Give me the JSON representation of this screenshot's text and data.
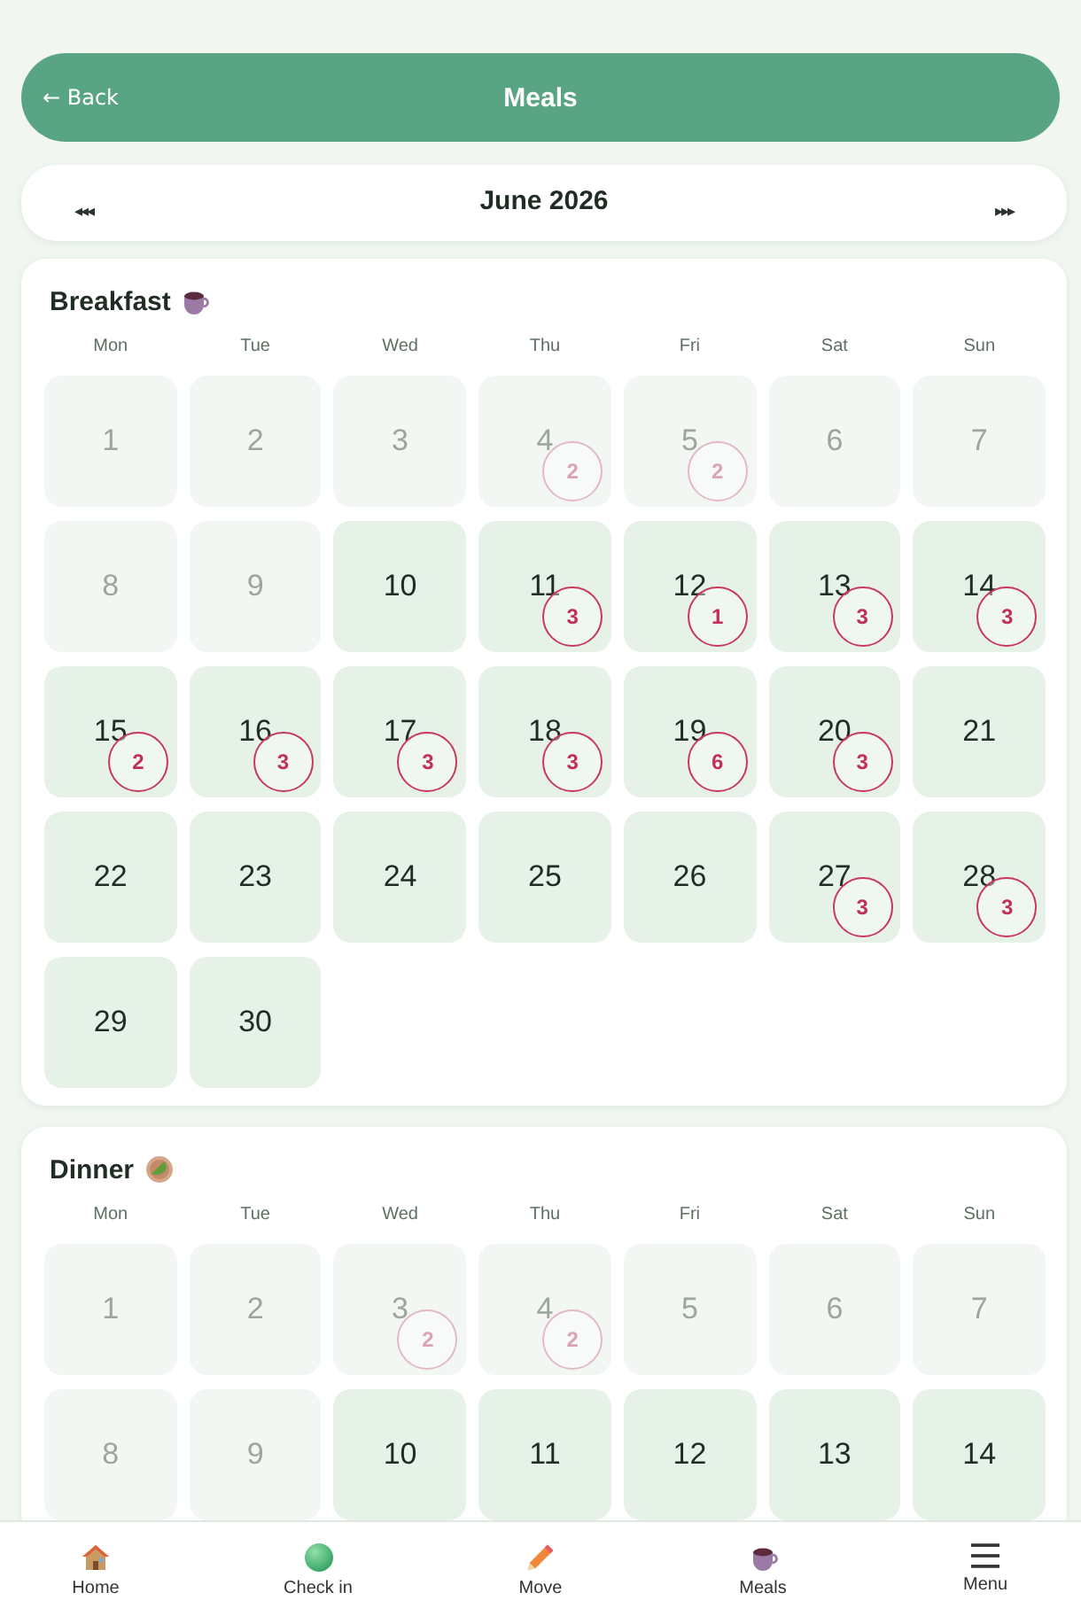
{
  "header": {
    "back": "← Back",
    "title": "Meals"
  },
  "month_nav": {
    "prev": "◂◂◂",
    "title": "June 2026",
    "next": "▸▸▸"
  },
  "calendars": [
    {
      "kind": "breakfast",
      "title": "Breakfast",
      "weekdays": [
        "Mon",
        "Tue",
        "Wed",
        "Thu",
        "Fri",
        "Sat",
        "Sun"
      ],
      "days": [
        {
          "day": "1",
          "past": true
        },
        {
          "day": "2",
          "past": true
        },
        {
          "day": "3",
          "past": true
        },
        {
          "day": "4",
          "past": true,
          "count": "2"
        },
        {
          "day": "5",
          "past": true,
          "count": "2"
        },
        {
          "day": "6",
          "past": true
        },
        {
          "day": "7",
          "past": true
        },
        {
          "day": "8",
          "past": true
        },
        {
          "day": "9",
          "past": true
        },
        {
          "day": "10",
          "past": false
        },
        {
          "day": "11",
          "past": false,
          "count": "3"
        },
        {
          "day": "12",
          "past": false,
          "count": "1"
        },
        {
          "day": "13",
          "past": false,
          "count": "3"
        },
        {
          "day": "14",
          "past": false,
          "count": "3"
        },
        {
          "day": "15",
          "past": false,
          "count": "2"
        },
        {
          "day": "16",
          "past": false,
          "count": "3"
        },
        {
          "day": "17",
          "past": false,
          "count": "3"
        },
        {
          "day": "18",
          "past": false,
          "count": "3"
        },
        {
          "day": "19",
          "past": false,
          "count": "6"
        },
        {
          "day": "20",
          "past": false,
          "count": "3"
        },
        {
          "day": "21",
          "past": false
        },
        {
          "day": "22",
          "past": false
        },
        {
          "day": "23",
          "past": false
        },
        {
          "day": "24",
          "past": false
        },
        {
          "day": "25",
          "past": false
        },
        {
          "day": "26",
          "past": false
        },
        {
          "day": "27",
          "past": false,
          "count": "3"
        },
        {
          "day": "28",
          "past": false,
          "count": "3"
        },
        {
          "day": "29",
          "past": false
        },
        {
          "day": "30",
          "past": false
        }
      ]
    },
    {
      "kind": "dinner",
      "title": "Dinner",
      "weekdays": [
        "Mon",
        "Tue",
        "Wed",
        "Thu",
        "Fri",
        "Sat",
        "Sun"
      ],
      "days": [
        {
          "day": "1",
          "past": true
        },
        {
          "day": "2",
          "past": true
        },
        {
          "day": "3",
          "past": true,
          "count": "2"
        },
        {
          "day": "4",
          "past": true,
          "count": "2"
        },
        {
          "day": "5",
          "past": true
        },
        {
          "day": "6",
          "past": true
        },
        {
          "day": "7",
          "past": true
        },
        {
          "day": "8",
          "past": true
        },
        {
          "day": "9",
          "past": true
        },
        {
          "day": "10",
          "past": false
        },
        {
          "day": "11",
          "past": false
        },
        {
          "day": "12",
          "past": false
        },
        {
          "day": "13",
          "past": false
        },
        {
          "day": "14",
          "past": false
        }
      ]
    }
  ],
  "bottom_nav": [
    {
      "kind": "home",
      "label": "Home"
    },
    {
      "kind": "check_in",
      "label": "Check in"
    },
    {
      "kind": "move",
      "label": "Move"
    },
    {
      "kind": "meals",
      "label": "Meals"
    },
    {
      "kind": "menu",
      "label": "Menu"
    }
  ]
}
